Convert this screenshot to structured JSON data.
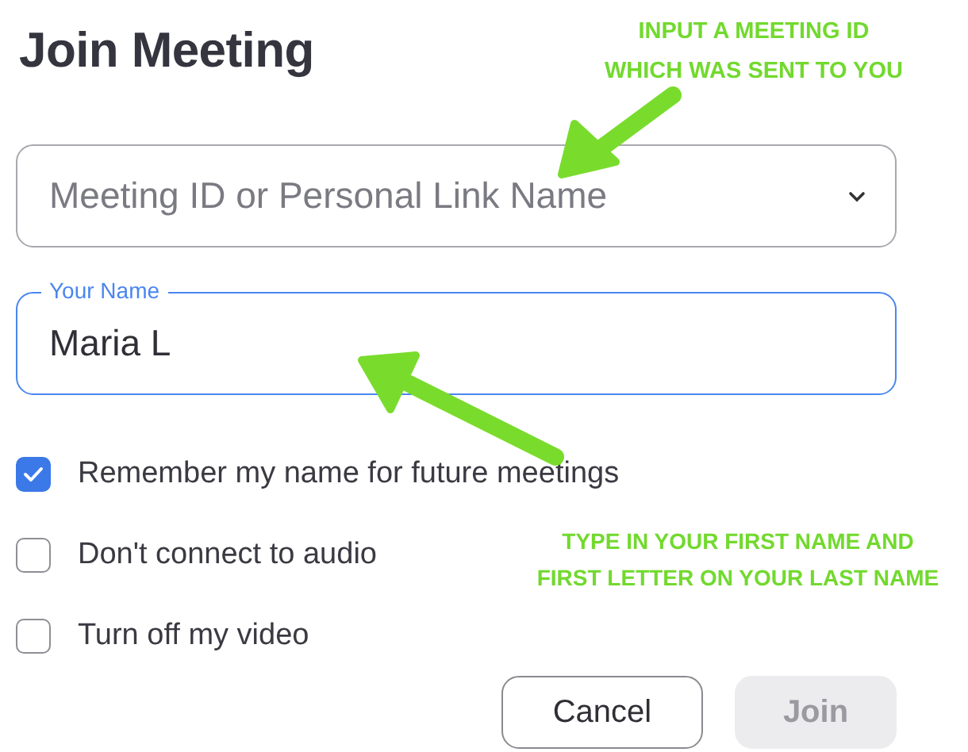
{
  "title": "Join Meeting",
  "meeting_field": {
    "placeholder": "Meeting ID or Personal Link Name"
  },
  "name_field": {
    "label": "Your Name",
    "value": "Maria L",
    "focused": true
  },
  "options": [
    {
      "label": "Remember my name for future meetings",
      "checked": true
    },
    {
      "label": "Don't connect to audio",
      "checked": false
    },
    {
      "label": "Turn off my video",
      "checked": false
    }
  ],
  "buttons": [
    {
      "label": "Cancel",
      "disabled": false
    },
    {
      "label": "Join",
      "disabled": true
    }
  ],
  "annotations": [
    {
      "lines": [
        "INPUT A MEETING ID",
        "WHICH WAS SENT TO YOU"
      ]
    },
    {
      "lines": [
        "TYPE IN YOUR FIRST NAME AND",
        "FIRST LETTER ON YOUR LAST NAME"
      ]
    }
  ]
}
